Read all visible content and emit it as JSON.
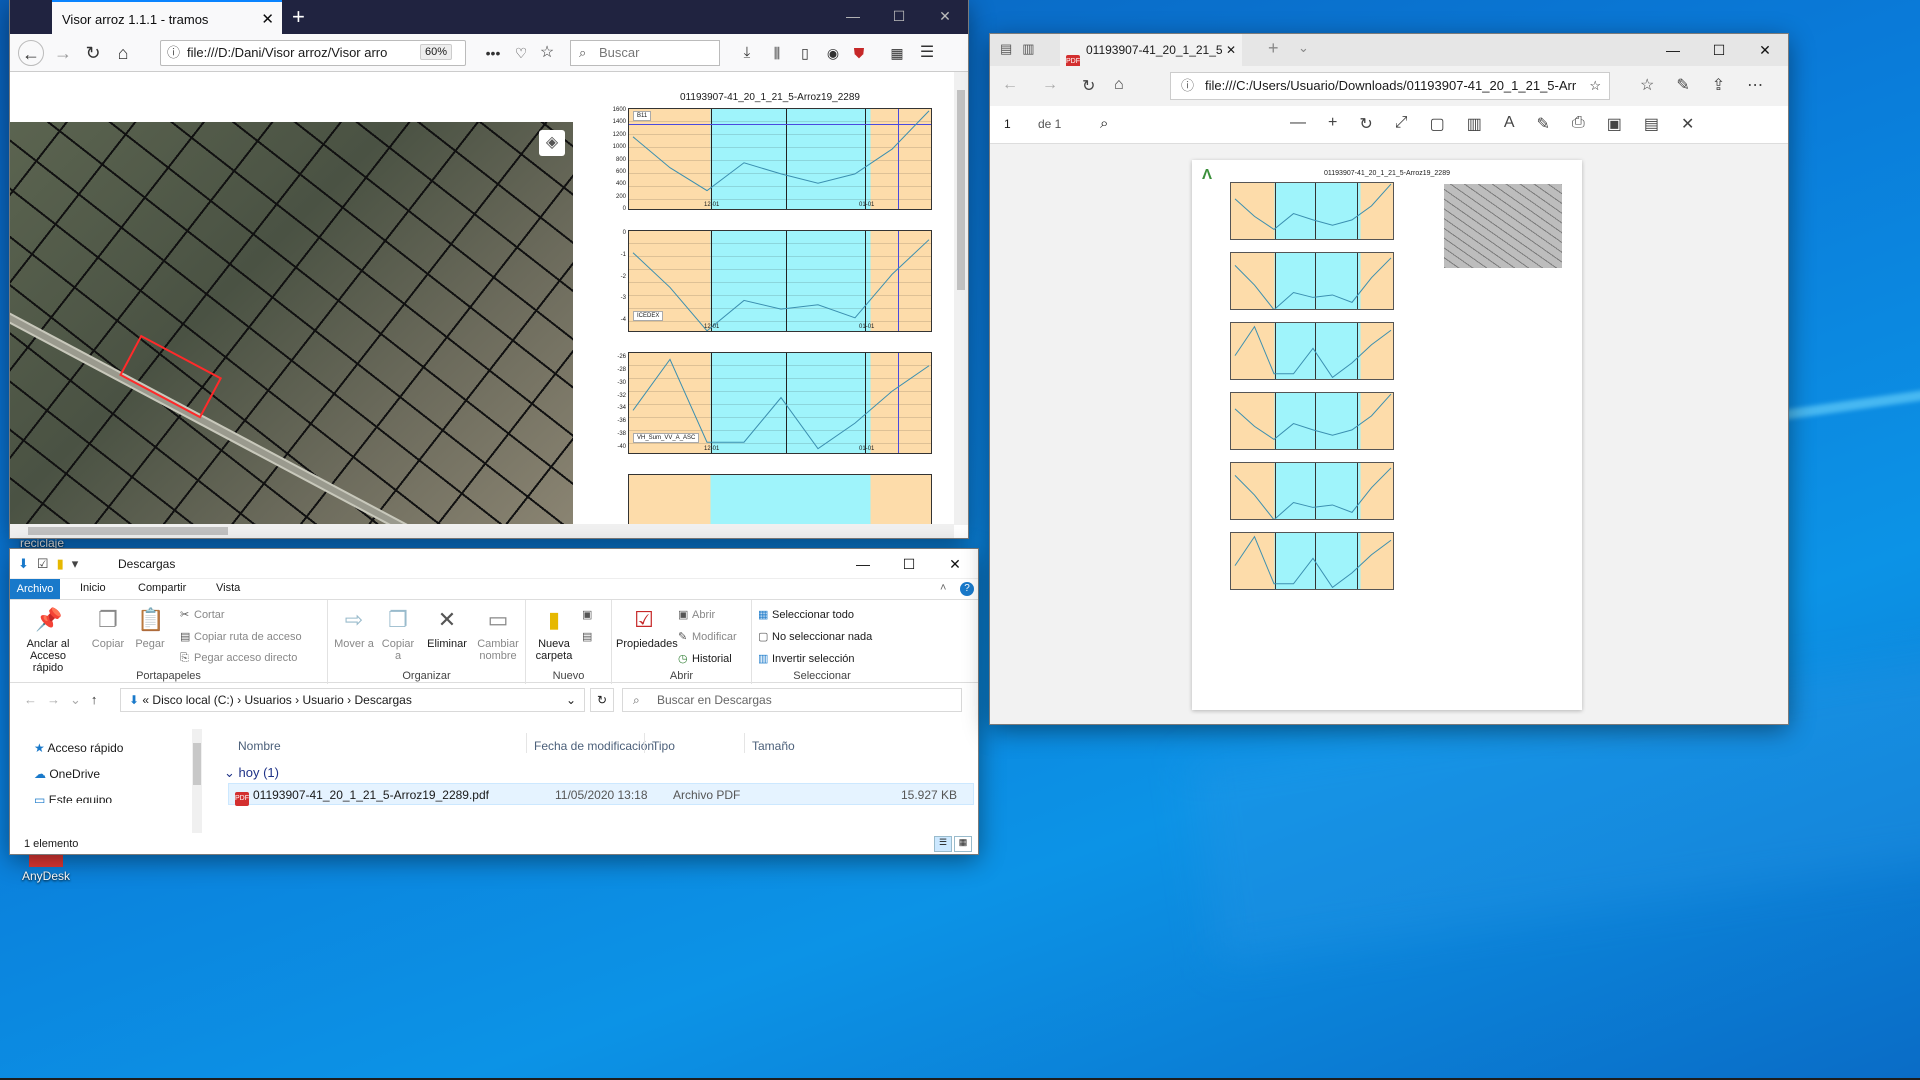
{
  "desktop": {
    "icons": [
      {
        "label": "reciclaje"
      },
      {
        "label": "AnyDesk"
      }
    ]
  },
  "firefox": {
    "tab_title": "Visor arroz 1.1.1 - tramos",
    "url": "file:///D:/Dani/Visor arroz/Visor arro",
    "zoom": "60%",
    "search_placeholder": "Buscar",
    "accent": "#0a84ff"
  },
  "explorer": {
    "title": "Descargas",
    "tabs": [
      "Archivo",
      "Inicio",
      "Compartir",
      "Vista"
    ],
    "ribbon": {
      "portapapeles": {
        "label": "Portapapeles",
        "anclar": "Anclar al Acceso rápido",
        "copiar": "Copiar",
        "pegar": "Pegar",
        "cortar": "Cortar",
        "copiar_ruta": "Copiar ruta de acceso",
        "pegar_acceso": "Pegar acceso directo"
      },
      "organizar": {
        "label": "Organizar",
        "mover": "Mover a",
        "copiar_a": "Copiar a",
        "eliminar": "Eliminar",
        "cambiar": "Cambiar nombre"
      },
      "nuevo": {
        "label": "Nuevo",
        "carpeta": "Nueva carpeta"
      },
      "abrir": {
        "label": "Abrir",
        "propiedades": "Propiedades",
        "abrir": "Abrir",
        "modificar": "Modificar",
        "historial": "Historial"
      },
      "seleccionar": {
        "label": "Seleccionar",
        "todo": "Seleccionar todo",
        "nada": "No seleccionar nada",
        "invertir": "Invertir selección"
      }
    },
    "breadcrumb": [
      "Disco local (C:)",
      "Usuarios",
      "Usuario",
      "Descargas"
    ],
    "search_placeholder": "Buscar en Descargas",
    "nav_items": [
      "Acceso rápido",
      "OneDrive",
      "Este equipo"
    ],
    "columns": [
      "Nombre",
      "Fecha de modificación",
      "Tipo",
      "Tamaño"
    ],
    "group": "hoy (1)",
    "files": [
      {
        "name": "01193907-41_20_1_21_5-Arroz19_2289.pdf",
        "date": "11/05/2020 13:18",
        "type": "Archivo PDF",
        "size": "15.927 KB"
      }
    ],
    "status": "1 elemento"
  },
  "edge": {
    "tab_title": "01193907-41_20_1_21_5",
    "url": "file:///C:/Users/Usuario/Downloads/01193907-41_20_1_21_5-Arr",
    "page": "1",
    "of": "de 1",
    "pdf_title": "01193907-41_20_1_21_5-Arroz19_2289"
  },
  "chart_data": {
    "type": "line",
    "title": "01193907-41_20_1_21_5-Arroz19_2289",
    "panels": [
      {
        "name": "B11",
        "yticks": [
          1600,
          1400,
          1200,
          1000,
          800,
          600,
          400,
          200,
          0
        ],
        "ylim": [
          0,
          1650
        ],
        "values": [
          1200,
          700,
          330,
          780,
          600,
          450,
          600,
          1000,
          1620
        ],
        "ref": 1400
      },
      {
        "name": "ICEDEX",
        "yticks": [
          0,
          -1,
          -2,
          -3,
          -4
        ],
        "ylim": [
          -4.5,
          0.2
        ],
        "values": [
          -0.8,
          -2.4,
          -4.4,
          -3.0,
          -3.4,
          -3.2,
          -3.8,
          -1.8,
          -0.2
        ]
      },
      {
        "name": "VH_Sum_VV_A_ASC",
        "yticks": [
          -26,
          -28,
          -30,
          -32,
          -34,
          -36,
          -38,
          -40
        ],
        "ylim": [
          -41,
          -25
        ],
        "values": [
          -34,
          -26,
          -39,
          -39,
          -32,
          -40,
          -36,
          -31,
          -27
        ]
      }
    ],
    "x_ticks": [
      "12-01",
      "01-01"
    ]
  }
}
